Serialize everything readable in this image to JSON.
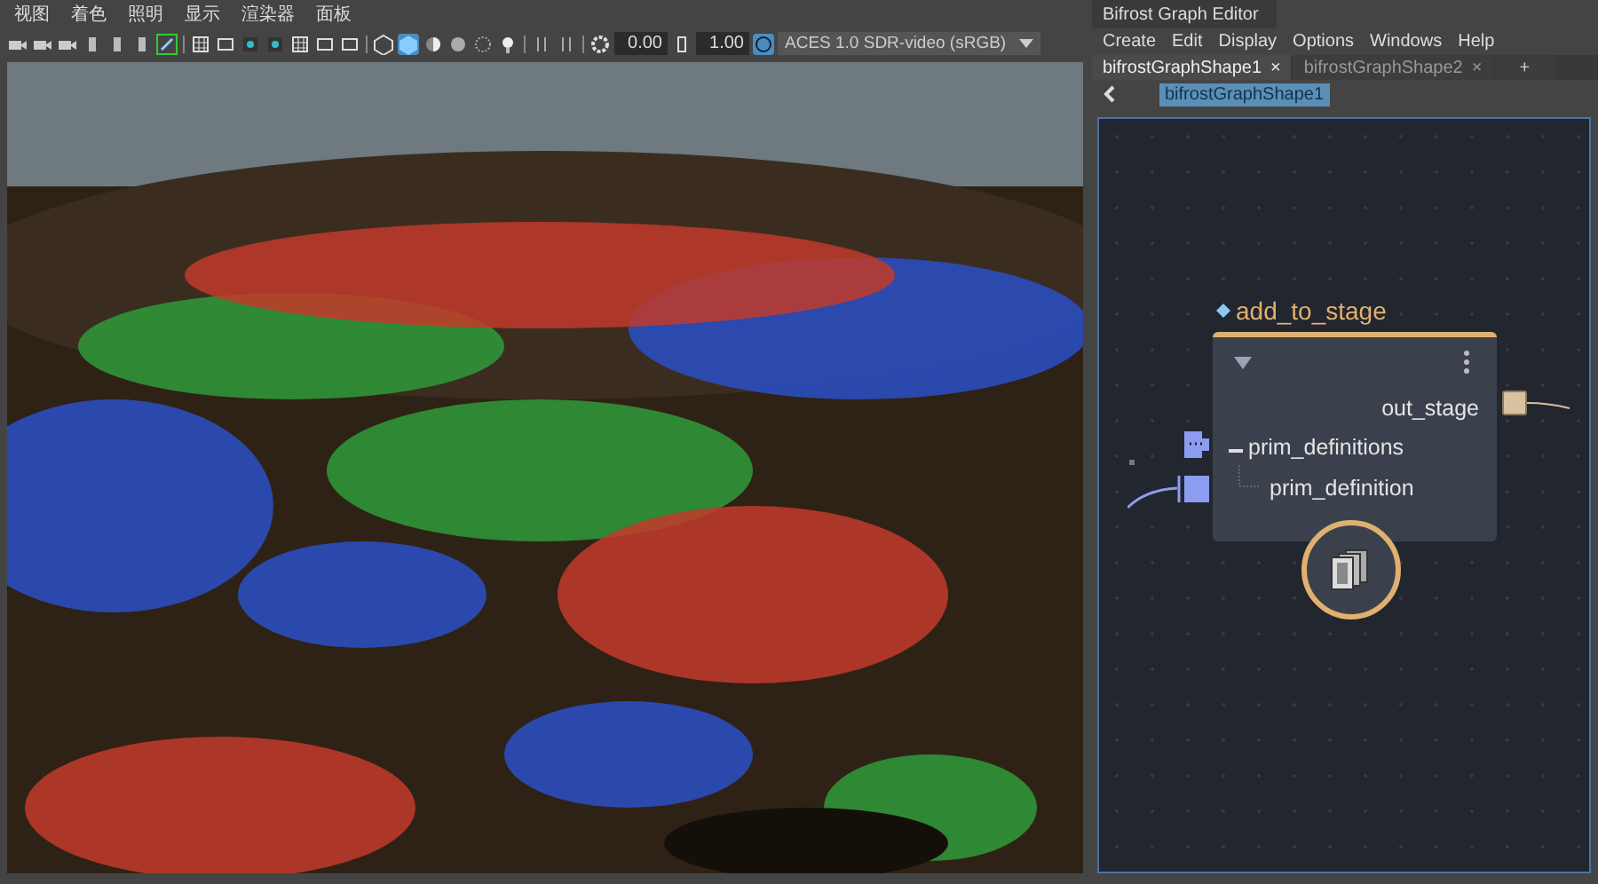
{
  "viewport": {
    "menu": [
      "视图",
      "着色",
      "照明",
      "显示",
      "渲染器",
      "面板"
    ],
    "toolbar": {
      "exposure": "0.00",
      "gamma": "1.00",
      "color_space": "ACES 1.0 SDR-video (sRGB)"
    }
  },
  "editor": {
    "title": "Bifrost Graph Editor",
    "menu": [
      "Create",
      "Edit",
      "Display",
      "Options",
      "Windows",
      "Help"
    ],
    "tabs": [
      {
        "label": "bifrostGraphShape1",
        "close": "×",
        "selected": true
      },
      {
        "label": "bifrostGraphShape2",
        "close": "×",
        "selected": false
      }
    ],
    "add_tab": "+",
    "breadcrumb": "bifrostGraphShape1",
    "node": {
      "title": "add_to_stage",
      "output": "out_stage",
      "inputs": [
        {
          "label": "prim_definitions",
          "children": [
            {
              "label": "prim_definition"
            }
          ]
        }
      ]
    }
  }
}
